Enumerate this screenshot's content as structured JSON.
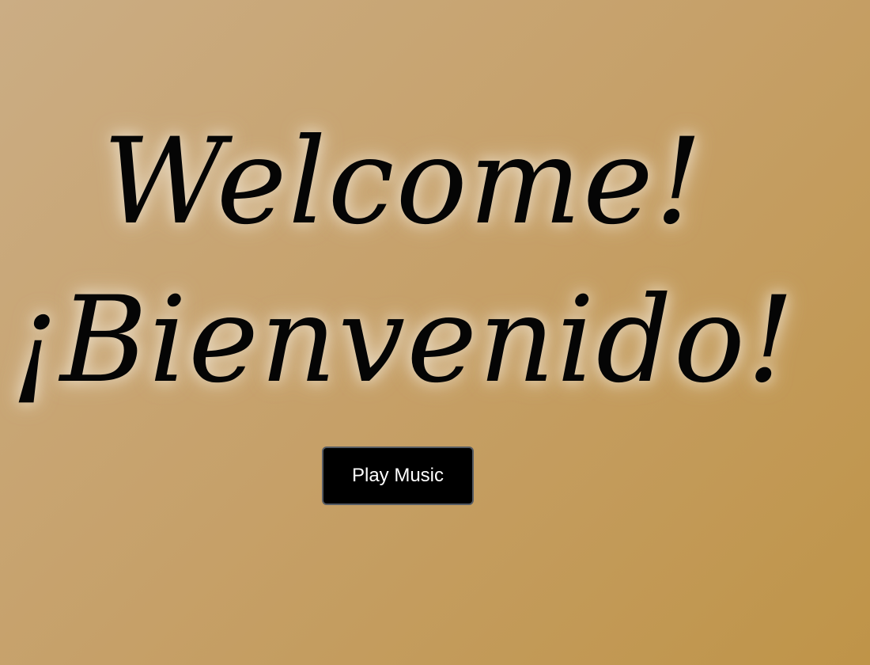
{
  "greeting": {
    "english": "Welcome!",
    "spanish": "¡Bienvenido!"
  },
  "controls": {
    "play_label": "Play Music"
  },
  "colors": {
    "background_start": "#cbad84",
    "background_end": "#bf9448",
    "text": "#050505",
    "glow": "#ebdec8",
    "button_background": "#000000",
    "button_text": "#ffffff",
    "button_border": "#555b63"
  }
}
